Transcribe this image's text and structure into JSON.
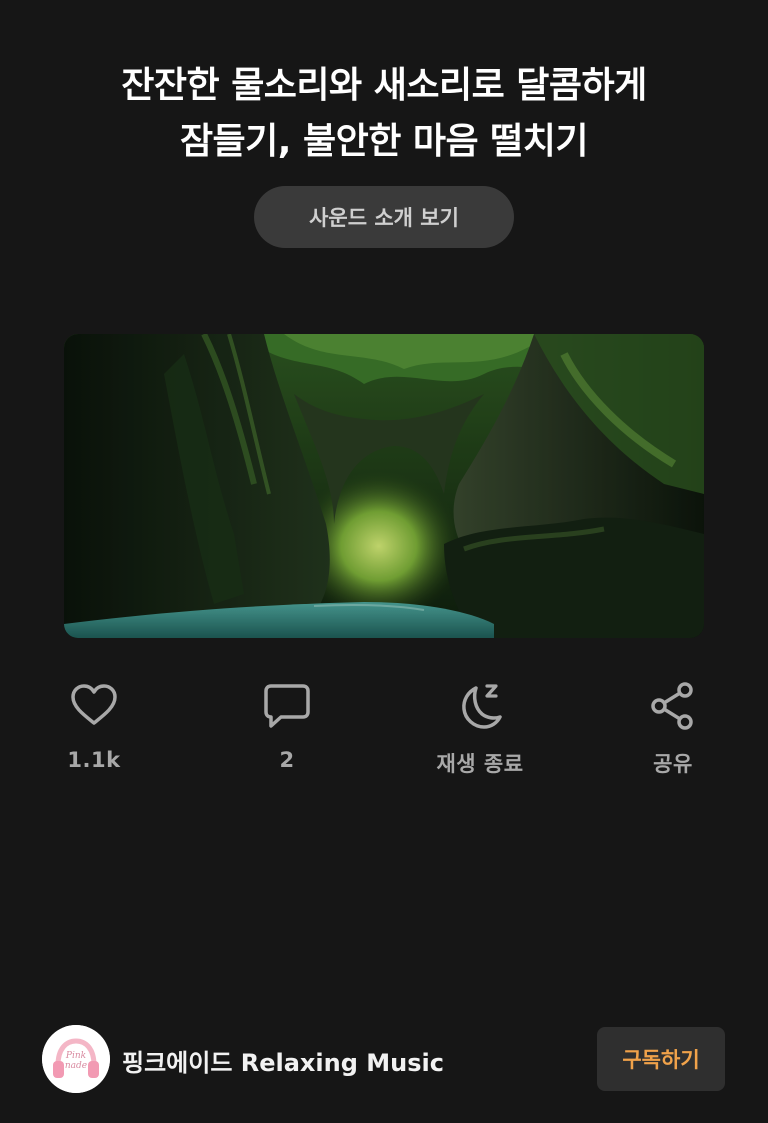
{
  "post": {
    "title_line1": "잔잔한 물소리와 새소리로 달콤하게",
    "title_line2": "잠들기, 불안한 마음 떨치기",
    "intro_button_label": "사운드 소개 보기"
  },
  "actions": {
    "like": {
      "label": "1.1k",
      "icon": "heart-icon"
    },
    "comment": {
      "label": "2",
      "icon": "comment-bubble-icon"
    },
    "sleep_timer": {
      "label": "재생 종료",
      "icon": "moon-sleep-icon"
    },
    "share": {
      "label": "공유",
      "icon": "share-icon"
    }
  },
  "channel": {
    "name": "핑크에이드 Relaxing Music",
    "avatar_logo_text": "Pink nade",
    "subscribe_label": "구독하기"
  },
  "colors": {
    "background": "#161616",
    "button_bg": "#3a3a3a",
    "icon_gray": "#a8a8a8",
    "subscribe_accent": "#f0a24a"
  }
}
